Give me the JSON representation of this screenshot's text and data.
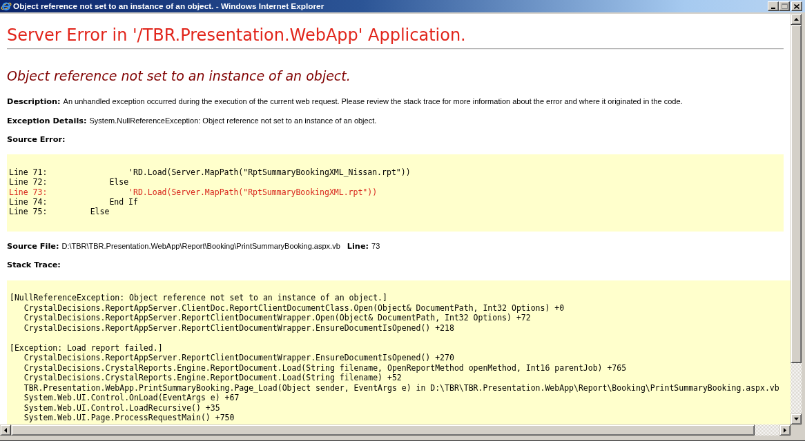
{
  "window": {
    "title": "Object reference not set to an instance of an object. - Windows Internet Explorer"
  },
  "page": {
    "heading": "Server Error in '/TBR.Presentation.WebApp' Application.",
    "error_title": "Object reference not set to an instance of an object.",
    "details": [
      {
        "label": "Description:",
        "text": "An unhandled exception occurred during the execution of the current web request. Please review the stack trace for more information about the error and where it originated in the code."
      },
      {
        "label": "Exception Details:",
        "text": "System.NullReferenceException: Object reference not set to an instance of an object."
      }
    ],
    "source_error": {
      "label": "Source Error:",
      "lines": [
        {
          "text": "Line 71:                 'RD.Load(Server.MapPath(\"RptSummaryBookingXML_Nissan.rpt\"))",
          "highlighted": false
        },
        {
          "text": "Line 72:             Else",
          "highlighted": false
        },
        {
          "text": "Line 73:                 'RD.Load(Server.MapPath(\"RptSummaryBookingXML.rpt\"))",
          "highlighted": true
        },
        {
          "text": "Line 74:             End If",
          "highlighted": false
        },
        {
          "text": "Line 75:         Else",
          "highlighted": false
        }
      ]
    },
    "source_file": {
      "label": "Source File:",
      "path": "D:\\TBR\\TBR.Presentation.WebApp\\Report\\Booking\\PrintSummaryBooking.aspx.vb",
      "line_label": "Line:",
      "line": "73"
    },
    "stack_trace": {
      "label": "Stack Trace:",
      "blocks": [
        {
          "header": "[NullReferenceException: Object reference not set to an instance of an object.]",
          "frames": [
            "CrystalDecisions.ReportAppServer.ClientDoc.ReportClientDocumentClass.Open(Object& DocumentPath, Int32 Options) +0",
            "CrystalDecisions.ReportAppServer.ReportClientDocumentWrapper.Open(Object& DocumentPath, Int32 Options) +72",
            "CrystalDecisions.ReportAppServer.ReportClientDocumentWrapper.EnsureDocumentIsOpened() +218"
          ]
        },
        {
          "header": "[Exception: Load report failed.]",
          "frames": [
            "CrystalDecisions.ReportAppServer.ReportClientDocumentWrapper.EnsureDocumentIsOpened() +270",
            "CrystalDecisions.CrystalReports.Engine.ReportDocument.Load(String filename, OpenReportMethod openMethod, Int16 parentJob) +765",
            "CrystalDecisions.CrystalReports.Engine.ReportDocument.Load(String filename) +52",
            "TBR.Presentation.WebApp.PrintSummaryBooking.Page_Load(Object sender, EventArgs e) in D:\\TBR\\TBR.Presentation.WebApp\\Report\\Booking\\PrintSummaryBooking.aspx.vb",
            "System.Web.UI.Control.OnLoad(EventArgs e) +67",
            "System.Web.UI.Control.LoadRecursive() +35",
            "System.Web.UI.Page.ProcessRequestMain() +750"
          ]
        }
      ]
    }
  }
}
